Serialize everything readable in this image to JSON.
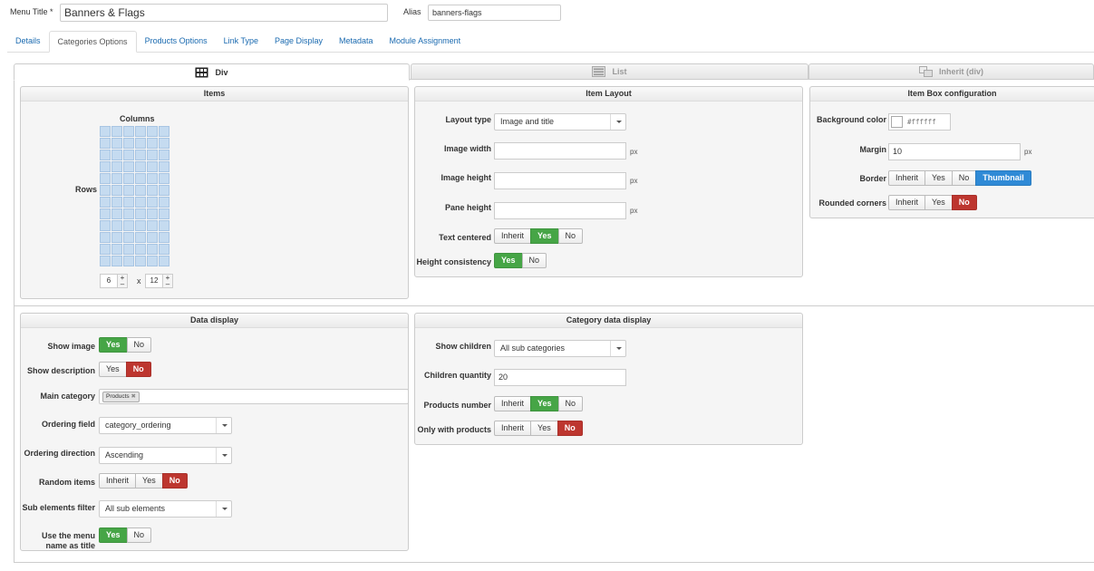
{
  "header": {
    "menu_title_label": "Menu Title *",
    "menu_title_value": "Banners & Flags",
    "alias_label": "Alias",
    "alias_value": "banners-flags"
  },
  "tabs": [
    "Details",
    "Categories Options",
    "Products Options",
    "Link Type",
    "Page Display",
    "Metadata",
    "Module Assignment"
  ],
  "active_tab": "Categories Options",
  "layout_tabs": {
    "div": "Div",
    "list": "List",
    "inherit": "Inherit (div)"
  },
  "items_panel": {
    "title": "Items",
    "columns_label": "Columns",
    "rows_label": "Rows",
    "columns_value": "6",
    "rows_value": "12",
    "times": "x",
    "plus": "+",
    "minus": "–"
  },
  "item_layout": {
    "title": "Item Layout",
    "layout_type_label": "Layout type",
    "layout_type_value": "Image and title",
    "image_width_label": "Image width",
    "image_height_label": "Image height",
    "pane_height_label": "Pane height",
    "unit": "px",
    "text_centered_label": "Text centered",
    "height_consistency_label": "Height consistency"
  },
  "item_box": {
    "title": "Item Box configuration",
    "bg_color_label": "Background color",
    "bg_color_value": "#ffffff",
    "margin_label": "Margin",
    "margin_value": "10",
    "unit": "px",
    "border_label": "Border",
    "rounded_label": "Rounded corners"
  },
  "data_display": {
    "title": "Data display",
    "show_image_label": "Show image",
    "show_description_label": "Show description",
    "main_category_label": "Main category",
    "main_category_tag": "Products",
    "tag_remove": "✖",
    "ordering_field_label": "Ordering field",
    "ordering_field_value": "category_ordering",
    "ordering_direction_label": "Ordering direction",
    "ordering_direction_value": "Ascending",
    "random_items_label": "Random items",
    "sub_filter_label": "Sub elements filter",
    "sub_filter_value": "All sub elements",
    "use_menu_name_label_1": "Use the menu",
    "use_menu_name_label_2": "name as title"
  },
  "category_display": {
    "title": "Category data display",
    "show_children_label": "Show children",
    "show_children_value": "All sub categories",
    "children_qty_label": "Children quantity",
    "children_qty_value": "20",
    "products_number_label": "Products number",
    "only_with_products_label": "Only with products"
  },
  "buttons": {
    "inherit": "Inherit",
    "yes": "Yes",
    "no": "No",
    "thumbnail": "Thumbnail"
  },
  "colors": {
    "yes_active": "#46a546",
    "no_active": "#bd362f",
    "thumbnail_active": "#2f8ad6",
    "link": "#1a6ab0"
  }
}
